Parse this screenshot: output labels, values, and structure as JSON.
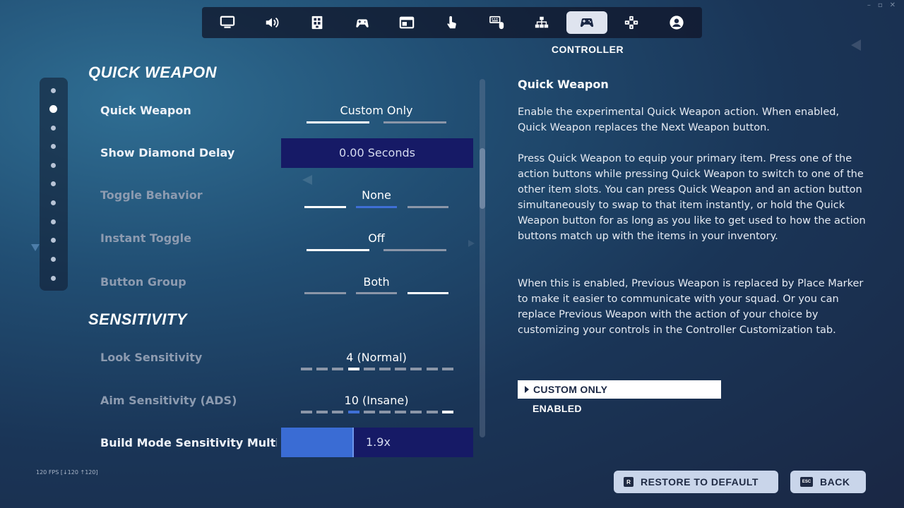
{
  "window": {
    "controls": [
      "–",
      "▫",
      "✕"
    ]
  },
  "nav": {
    "tabs": [
      {
        "icon": "monitor-icon"
      },
      {
        "icon": "speaker-icon"
      },
      {
        "icon": "grid-icon"
      },
      {
        "icon": "gamepad-wireless-icon"
      },
      {
        "icon": "window-icon"
      },
      {
        "icon": "touch-icon"
      },
      {
        "icon": "keyboard-mouse-icon"
      },
      {
        "icon": "network-icon"
      },
      {
        "icon": "controller-icon",
        "active": true
      },
      {
        "icon": "dpad-icon"
      },
      {
        "icon": "account-icon"
      }
    ],
    "active_label": "CONTROLLER"
  },
  "sections": {
    "quick_weapon": "QUICK WEAPON",
    "sensitivity": "SENSITIVITY"
  },
  "settings": {
    "quick_weapon": {
      "label": "Quick Weapon",
      "value": "Custom Only",
      "option_count": 2,
      "selected_index": 0
    },
    "show_diamond_delay": {
      "label": "Show Diamond Delay",
      "value": "0.00 Seconds"
    },
    "toggle_behavior": {
      "label": "Toggle Behavior",
      "value": "None",
      "option_count": 3,
      "selected_index": 0
    },
    "instant_toggle": {
      "label": "Instant Toggle",
      "value": "Off",
      "option_count": 2,
      "selected_index": 0
    },
    "button_group": {
      "label": "Button Group",
      "value": "Both",
      "option_count": 3,
      "selected_index": 2
    },
    "look_sensitivity": {
      "label": "Look Sensitivity",
      "value": "4 (Normal)",
      "steps": 10,
      "selected_step": 4
    },
    "aim_sensitivity": {
      "label": "Aim Sensitivity (ADS)",
      "value": "10 (Insane)",
      "steps": 10,
      "selected_step": 10
    },
    "build_mode": {
      "label": "Build Mode Sensitivity Multip",
      "value": "1.9x",
      "fill_fraction": 0.38
    }
  },
  "description": {
    "title": "Quick Weapon",
    "paragraphs": [
      "Enable the experimental Quick Weapon action. When enabled, Quick Weapon replaces the Next Weapon button.",
      "Press Quick Weapon to equip your primary item. Press one of the action buttons while pressing Quick Weapon to switch to one of the other item slots. You can press Quick Weapon and an action button simultaneously to swap to that item instantly, or hold the Quick Weapon button for as long as you like to get used to how the action buttons match up with the items in your inventory.",
      "When this is enabled, Previous Weapon is replaced by Place Marker to make it easier to communicate with your squad. Or you can replace Previous Weapon with the action of your choice by customizing your controls in the Controller Customization tab."
    ],
    "options": [
      "CUSTOM ONLY",
      "ENABLED"
    ]
  },
  "buttons": {
    "restore": {
      "key": "R",
      "label": "RESTORE TO DEFAULT"
    },
    "back": {
      "key": "ESC",
      "label": "BACK"
    }
  },
  "fps": "120 FPS [↓120 ↑120]",
  "colors": {
    "accent_blue": "#3a6cd4",
    "highlight_bg": "#161a66",
    "button_bg": "#c9d5ea"
  }
}
